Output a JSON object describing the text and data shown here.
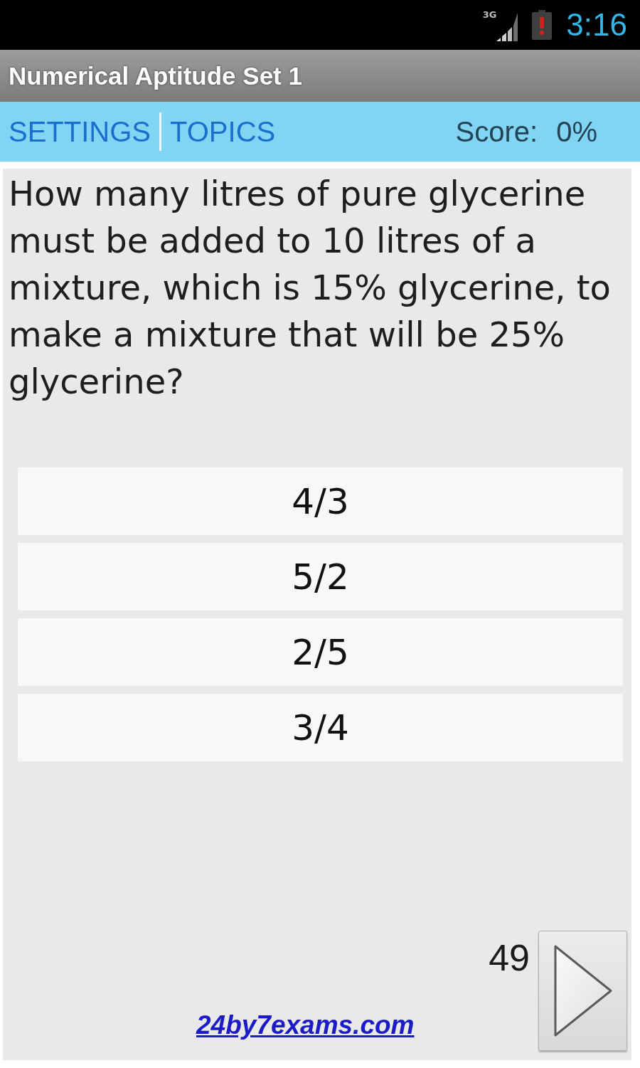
{
  "status_bar": {
    "network_type": "3G",
    "time": "3:16"
  },
  "title_bar": {
    "title": "Numerical Aptitude Set 1"
  },
  "nav_bar": {
    "links": [
      {
        "label": "SETTINGS"
      },
      {
        "label": "TOPICS"
      }
    ],
    "score_label": "Score:",
    "score_value": "0%"
  },
  "question": {
    "text": "How many litres of pure glycerine must be added to 10 litres of a mixture, which is 15% glycerine, to make a mixture that will be 25% glycerine?",
    "options": [
      {
        "label": "4/3"
      },
      {
        "label": "5/2"
      },
      {
        "label": "2/5"
      },
      {
        "label": "3/4"
      }
    ]
  },
  "footer": {
    "question_number": "49",
    "website_link": "24by7exams.com"
  }
}
